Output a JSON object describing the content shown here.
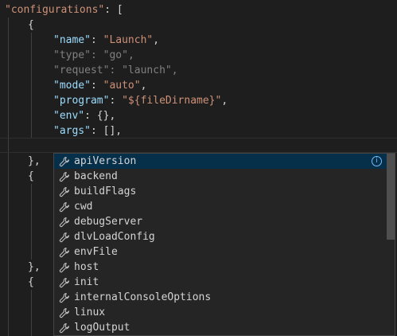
{
  "colors": {
    "editor_bg": "#1e1e1e",
    "key": "#9cdcfe",
    "string": "#ce9178",
    "punct": "#d4d4d4",
    "dim": "#808080",
    "suggest_bg": "#252526",
    "suggest_selected": "#062f4a",
    "info": "#75beff"
  },
  "code": {
    "configurations_key": "\"configurations\"",
    "configurations_rest": ": [",
    "open_brace": "{",
    "name_key": "\"name\"",
    "name_value": "\"Launch\"",
    "type_key": "\"type\"",
    "type_value": "\"go\"",
    "request_key": "\"request\"",
    "request_value": "\"launch\"",
    "mode_key": "\"mode\"",
    "mode_value": "\"auto\"",
    "program_key": "\"program\"",
    "program_value": "\"${fileDirname}\"",
    "env_key": "\"env\"",
    "env_value": "{}",
    "args_key": "\"args\"",
    "args_value": "[]",
    "colon": ": ",
    "comma": ",",
    "close_brace_comma": "},",
    "open_brace_2": "{",
    "close_brace_comma_2": "},",
    "open_brace_3": "{"
  },
  "suggest": {
    "icon": "wrench-icon",
    "info_icon": "info-icon",
    "info_glyph": "i",
    "items": [
      "apiVersion",
      "backend",
      "buildFlags",
      "cwd",
      "debugServer",
      "dlvLoadConfig",
      "envFile",
      "host",
      "init",
      "internalConsoleOptions",
      "linux",
      "logOutput"
    ],
    "selected_index": 0
  }
}
